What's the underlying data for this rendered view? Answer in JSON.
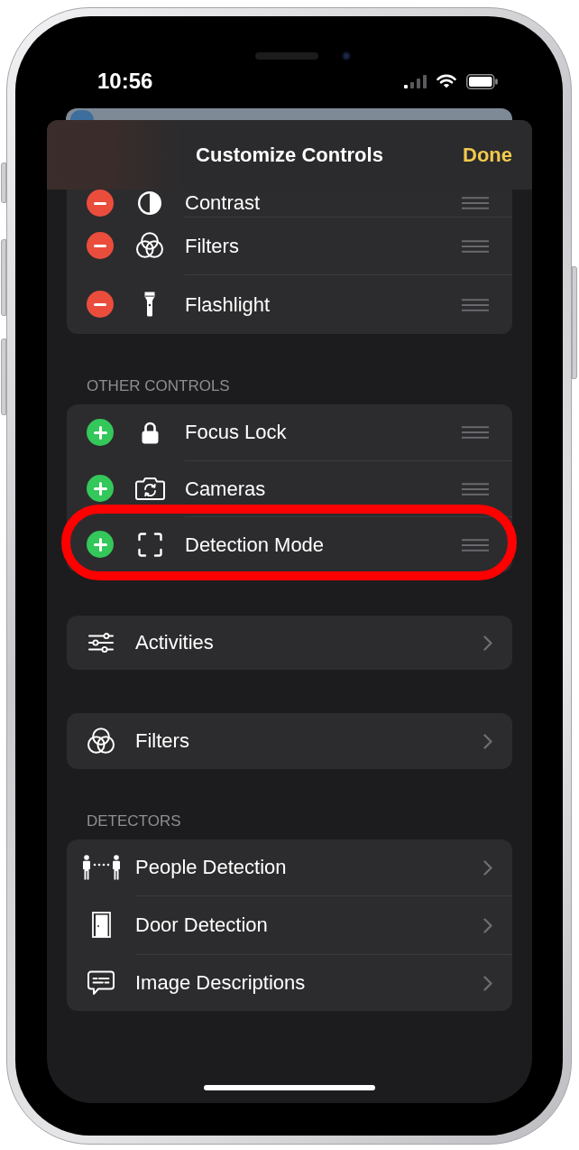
{
  "status_bar": {
    "time": "10:56"
  },
  "sheet": {
    "title": "Customize Controls",
    "done_button": "Done"
  },
  "sections": [
    {
      "kind": "included",
      "rows": [
        {
          "label": "Contrast"
        },
        {
          "label": "Filters"
        },
        {
          "label": "Flashlight"
        }
      ]
    },
    {
      "kind": "available",
      "header": "OTHER CONTROLS",
      "rows": [
        {
          "label": "Focus Lock",
          "highlighted": false
        },
        {
          "label": "Cameras",
          "highlighted": false
        },
        {
          "label": "Detection Mode",
          "highlighted": true
        }
      ]
    },
    {
      "kind": "link",
      "rows": [
        {
          "label": "Activities"
        }
      ]
    },
    {
      "kind": "link",
      "rows": [
        {
          "label": "Filters"
        }
      ]
    },
    {
      "kind": "link",
      "header": "DETECTORS",
      "rows": [
        {
          "label": "People Detection"
        },
        {
          "label": "Door Detection"
        },
        {
          "label": "Image Descriptions"
        }
      ]
    }
  ]
}
